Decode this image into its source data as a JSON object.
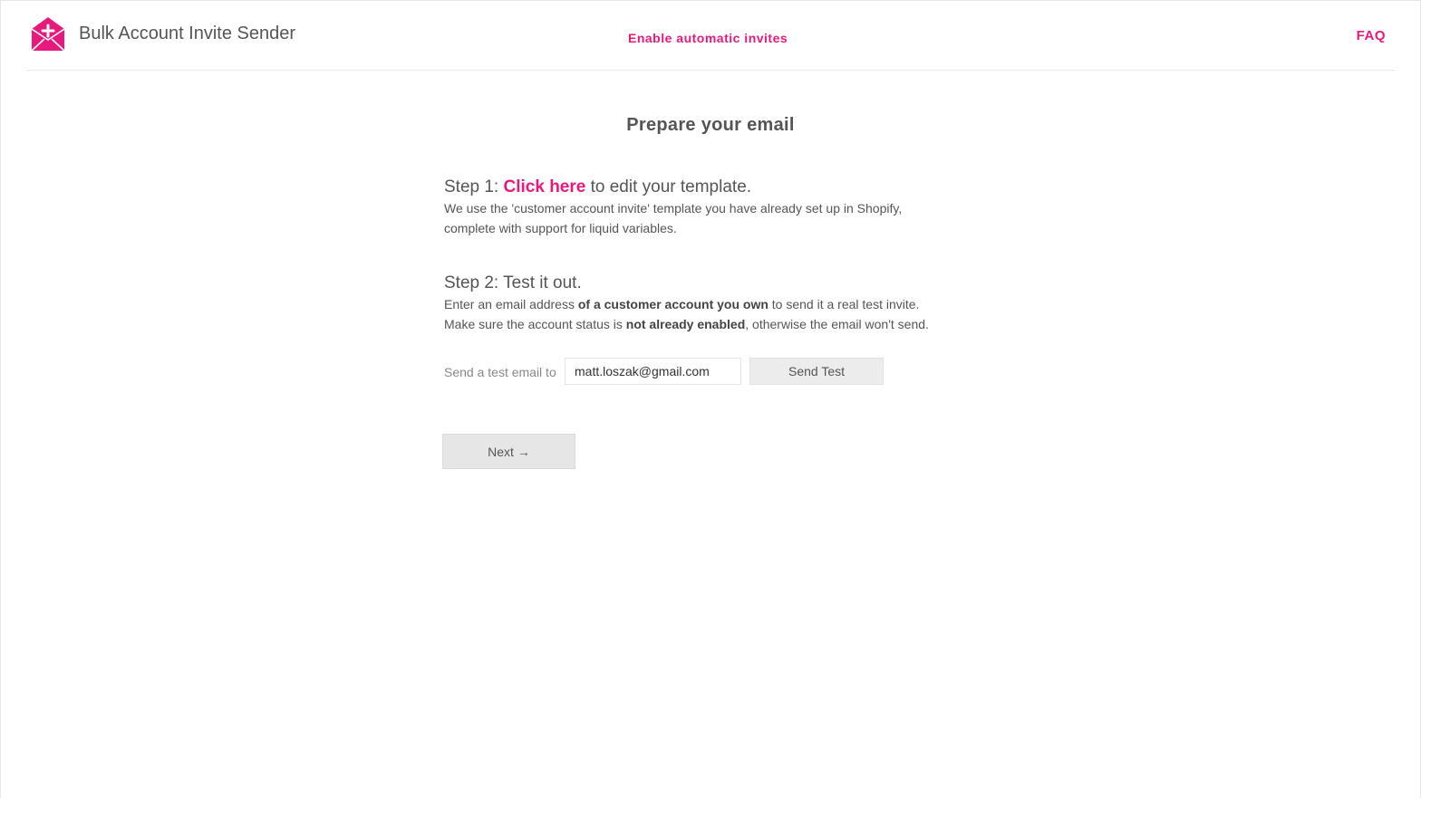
{
  "header": {
    "app_title": "Bulk Account Invite Sender",
    "nav_center": "Enable automatic invites",
    "nav_faq": "FAQ",
    "logo_icon": "envelope-plus-icon",
    "brand_color": "#e8197d"
  },
  "main": {
    "title": "Prepare your email",
    "step1": {
      "prefix": "Step 1: ",
      "link": "Click here",
      "suffix": " to edit your template.",
      "line1": "We use the 'customer account invite' template you have already set up in Shopify,",
      "line2": "complete with support for liquid variables."
    },
    "step2": {
      "heading": "Step 2: Test it out.",
      "line1_a": "Enter an email address ",
      "line1_b": "of a customer account you own",
      "line1_c": " to send it a real test invite.",
      "line2_a": "Make sure the account status is ",
      "line2_b": "not already enabled",
      "line2_c": ", otherwise the email won't send."
    },
    "test": {
      "label": "Send a test email to",
      "email_value": "matt.loszak@gmail.com",
      "send_label": "Send Test"
    },
    "next_label": "Next →"
  }
}
